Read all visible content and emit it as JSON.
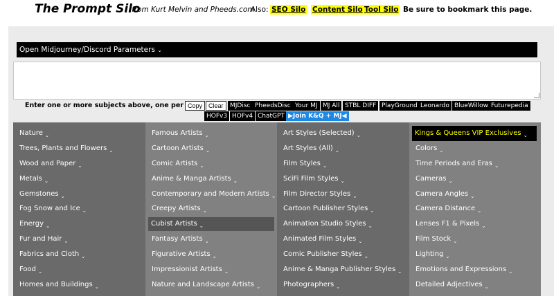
{
  "header": {
    "title": "The Prompt Silo",
    "byline": "from Kurt Melvin and Pheeds.com",
    "also_label": "Also:",
    "links": [
      "SEO Silo",
      "Content Silo",
      "Tool Silo"
    ],
    "bookmark_text": "Be sure to bookmark this page."
  },
  "params_bar": {
    "label": "Open Midjourney/Discord Parameters",
    "chevron": "⌄"
  },
  "input": {
    "value": "",
    "placeholder": ""
  },
  "instructions": "Enter one or more subjects above, one per line.",
  "buttons_light": [
    "Copy",
    "Clear"
  ],
  "buttons_dark_row1": [
    "MJDisc",
    "PheedsDisc",
    "Your MJ",
    "MJ All",
    "STBL DIFF",
    "PlayGround",
    "Leonardo",
    "BlueWillow",
    "Futurepedia"
  ],
  "buttons_dark_row2": [
    "HOFv3",
    "HOFv4",
    "ChatGPT"
  ],
  "join_button": "▶Join K&Q + MJ◀",
  "menu": {
    "col1": [
      "Nature",
      "Trees, Plants and Flowers",
      "Wood and Paper",
      "Metals",
      "Gemstones",
      "Fog Snow and Ice",
      "Energy",
      "Fur and Hair",
      "Fabrics and Cloth",
      "Food",
      "Homes and Buildings"
    ],
    "col2": [
      "Famous Artists",
      "Cartoon Artists",
      "Comic Artists",
      "Anime & Manga Artists",
      "Contemporary and Modern Artists",
      "Creepy Artists",
      "Cubist Artists",
      "Fantasy Artists",
      "Figurative Artists",
      "Impressionist Artists",
      "Nature and Landscape Artists"
    ],
    "col3": [
      "Art Styles (Selected)",
      "Art Styles (All)",
      "Film Styles",
      "SciFi Film Styles",
      "Film Director Styles",
      "Cartoon Publisher Styles",
      "Animation Studio Styles",
      "Animated Film Styles",
      "Comic Publisher Styles",
      "Anime & Manga Publisher Styles",
      "Photographers"
    ],
    "col4_vip": "Kings & Queens VIP Exclusives",
    "col4": [
      "Colors",
      "Time Periods and Eras",
      "Cameras",
      "Camera Angles",
      "Camera Distance",
      "Lenses F1 & Pixels",
      "Film Stock",
      "Lighting",
      "Emotions and Expressions",
      "Detailed Adjectives"
    ],
    "active_item": "Cubist Artists"
  }
}
